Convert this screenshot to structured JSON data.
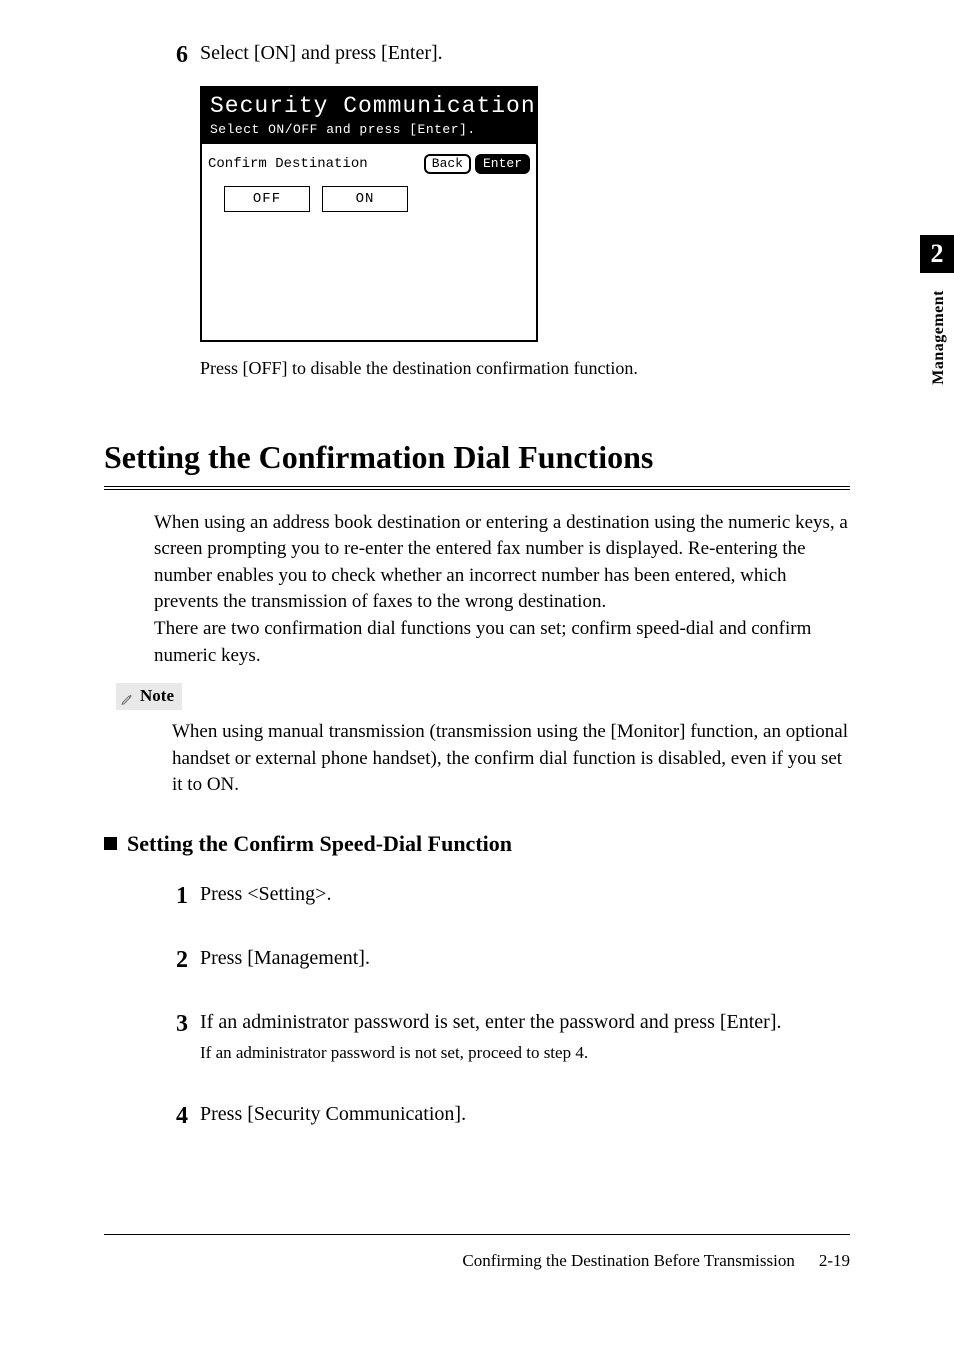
{
  "chapter": {
    "number": "2",
    "sideLabel": "Management"
  },
  "step6": {
    "num": "6",
    "text": "Select [ON] and press [Enter]."
  },
  "lcd": {
    "title": "Security Communication",
    "subtitle": "Select ON/OFF and press [Enter].",
    "rowLabel": "Confirm Destination",
    "backBtn": "Back",
    "enterBtn": "Enter",
    "optOff": "OFF",
    "optOn": "ON"
  },
  "afterLcd": "Press [OFF] to disable the destination confirmation function.",
  "h1": "Setting the Confirmation Dial Functions",
  "para1": "When using an address book destination or entering a destination using the numeric keys, a screen prompting you to re-enter the entered fax number is displayed. Re-entering the number enables you to check whether an incorrect number has been entered, which prevents the transmission of faxes to the wrong destination.\nThere are two confirmation dial functions you can set; confirm speed-dial and confirm numeric keys.",
  "note": {
    "label": "Note",
    "body": "When using manual transmission (transmission using the [Monitor] function, an optional handset or external phone handset), the confirm dial function is disabled, even if you set it to ON."
  },
  "h2": "Setting the Confirm Speed-Dial Function",
  "steps": [
    {
      "num": "1",
      "text": "Press <Setting>."
    },
    {
      "num": "2",
      "text": "Press [Management]."
    },
    {
      "num": "3",
      "text": "If an administrator password is set, enter the password and press [Enter].",
      "sub": "If an administrator password is not set, proceed to step 4."
    },
    {
      "num": "4",
      "text": "Press [Security Communication]."
    }
  ],
  "footer": {
    "running": "Confirming the Destination Before Transmission",
    "page": "2-19"
  }
}
